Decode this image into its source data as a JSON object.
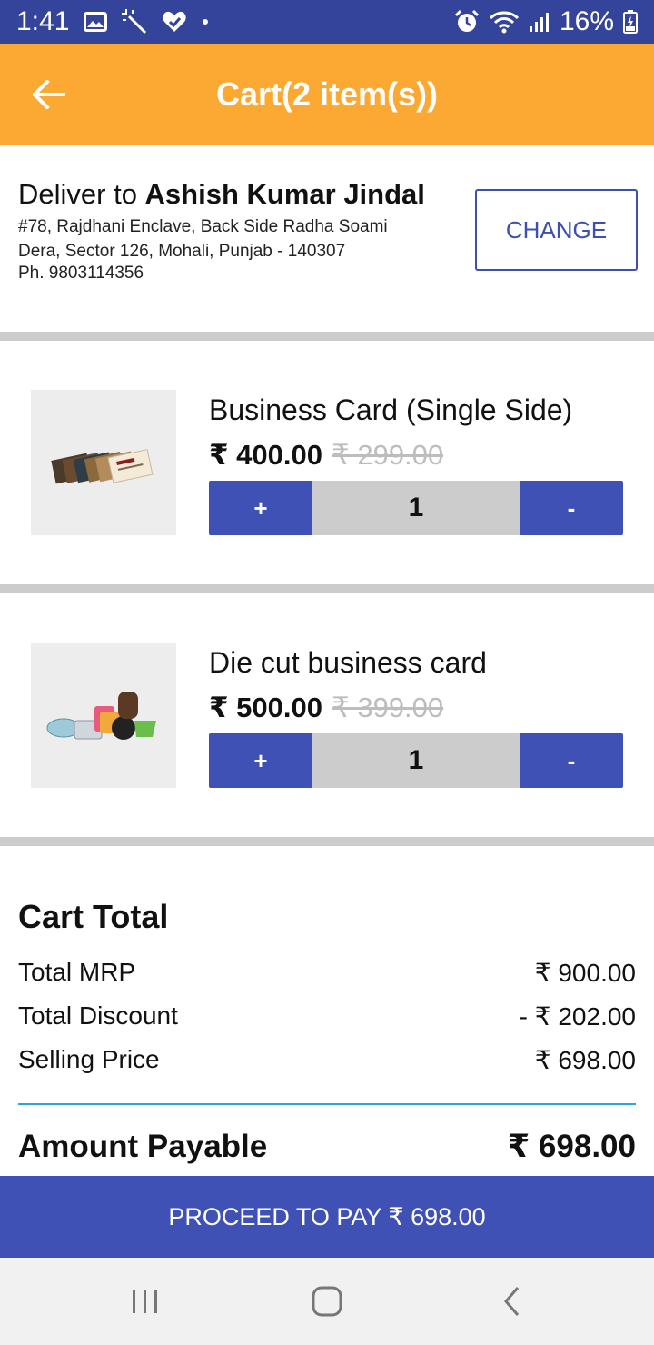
{
  "status_bar": {
    "time": "1:41",
    "battery": "16%",
    "left_icons": [
      "gallery-icon",
      "magic-wand-icon",
      "heart-check-icon",
      "dot-icon"
    ],
    "right_icons": [
      "alarm-icon",
      "wifi-icon",
      "signal-icon",
      "battery-icon"
    ]
  },
  "app_bar": {
    "title": "Cart(2 item(s))",
    "back_icon": "arrow-left-icon"
  },
  "delivery": {
    "prefix": "Deliver to ",
    "name": "Ashish Kumar Jindal",
    "address_line1": "#78, Rajdhani Enclave, Back Side Radha Soami",
    "address_line2": "Dera, Sector 126, Mohali, Punjab - 140307",
    "phone": "Ph. 9803114356",
    "change_label": "CHANGE"
  },
  "cart_items": [
    {
      "name": "Business Card (Single Side)",
      "price": "₹ 400.00",
      "old_price": "₹ 299.00",
      "quantity": "1",
      "plus_label": "+",
      "minus_label": "-"
    },
    {
      "name": "Die cut business card",
      "price": "₹ 500.00",
      "old_price": "₹ 399.00",
      "quantity": "1",
      "plus_label": "+",
      "minus_label": "-"
    }
  ],
  "totals": {
    "title": "Cart Total",
    "rows": [
      {
        "label": "Total MRP",
        "value": "₹ 900.00"
      },
      {
        "label": "Total Discount",
        "value": "- ₹ 202.00"
      },
      {
        "label": "Selling Price",
        "value": "₹ 698.00"
      }
    ],
    "payable_label": "Amount Payable",
    "payable_value": "₹ 698.00"
  },
  "proceed_label": "PROCEED TO PAY ₹ 698.00",
  "nav_bar": {
    "icons": [
      "recent-apps-icon",
      "home-icon",
      "back-icon"
    ]
  },
  "colors": {
    "status_bar": "#34449a",
    "app_bar": "#fba933",
    "primary": "#3f51b5",
    "divider": "#cccccc",
    "total_separator": "#29a8d6"
  }
}
